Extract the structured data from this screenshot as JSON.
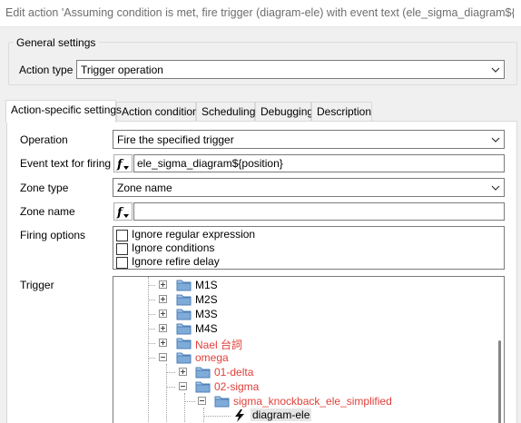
{
  "window": {
    "title": "Edit action 'Assuming condition is met, fire trigger (diagram-ele) with event text (ele_sigma_diagram${p..."
  },
  "general": {
    "group_label": "General settings",
    "action_type_label": "Action type",
    "action_type_value": "Trigger operation"
  },
  "tabs": [
    {
      "label": "Action-specific settings",
      "active": true
    },
    {
      "label": "Action condition",
      "active": false
    },
    {
      "label": "Scheduling",
      "active": false
    },
    {
      "label": "Debugging",
      "active": false
    },
    {
      "label": "Description",
      "active": false
    }
  ],
  "form": {
    "operation_label": "Operation",
    "operation_value": "Fire the specified trigger",
    "event_text_label": "Event text for firing",
    "event_text_value": "ele_sigma_diagram${position}",
    "zone_type_label": "Zone type",
    "zone_type_value": "Zone name",
    "zone_name_label": "Zone name",
    "zone_name_value": "",
    "firing_options_label": "Firing options",
    "firing_options": [
      {
        "label": "Ignore regular expression",
        "checked": false
      },
      {
        "label": "Ignore conditions",
        "checked": false
      },
      {
        "label": "Ignore refire delay",
        "checked": false
      }
    ],
    "trigger_label": "Trigger"
  },
  "tree": {
    "nodes": [
      {
        "label": "M1S",
        "level": 0,
        "color": "normal",
        "expanded": false
      },
      {
        "label": "M2S",
        "level": 0,
        "color": "normal",
        "expanded": false
      },
      {
        "label": "M3S",
        "level": 0,
        "color": "normal",
        "expanded": false
      },
      {
        "label": "M4S",
        "level": 0,
        "color": "normal",
        "expanded": false
      },
      {
        "label": "Nael 台詞",
        "level": 0,
        "color": "red",
        "expanded": false
      },
      {
        "label": "omega",
        "level": 0,
        "color": "red",
        "expanded": true
      },
      {
        "label": "01-delta",
        "level": 1,
        "color": "red",
        "expanded": false
      },
      {
        "label": "02-sigma",
        "level": 1,
        "color": "red",
        "expanded": true
      },
      {
        "label": "sigma_knockback_ele_simplified",
        "level": 2,
        "color": "red",
        "expanded": true
      },
      {
        "label": "diagram-ele",
        "level": 3,
        "color": "normal",
        "type": "trigger",
        "selected": true
      }
    ]
  },
  "colors": {
    "accent_red": "#e0403a",
    "folder_blue": "#5a8fc8"
  }
}
